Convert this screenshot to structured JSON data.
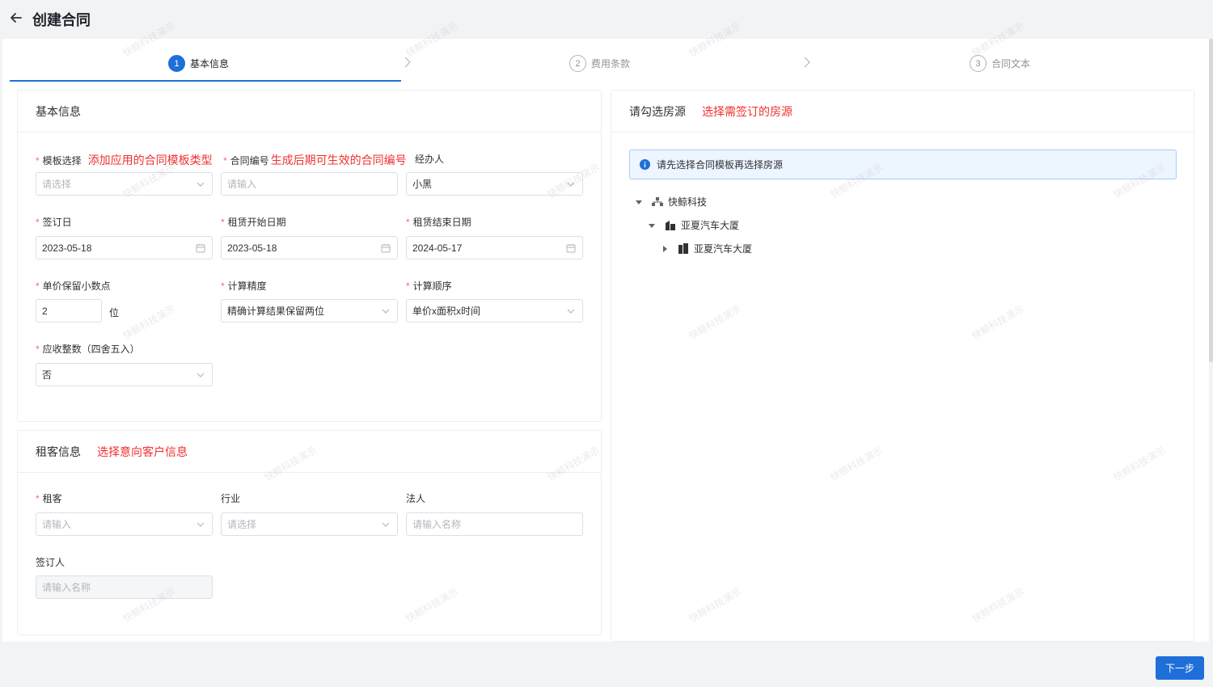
{
  "header": {
    "title": "创建合同"
  },
  "steps": [
    {
      "num": "1",
      "label": "基本信息"
    },
    {
      "num": "2",
      "label": "费用条款"
    },
    {
      "num": "3",
      "label": "合同文本"
    }
  ],
  "basic": {
    "title": "基本信息",
    "template": {
      "label": "模板选择",
      "annotation": "添加应用的合同模板类型",
      "placeholder": "请选择"
    },
    "contract_no": {
      "label": "合同编号",
      "annotation": "生成后期可生效的合同编号",
      "placeholder": "请输入"
    },
    "handler": {
      "label": "经办人",
      "value": "小黑"
    },
    "sign_date": {
      "label": "签订日",
      "value": "2023-05-18"
    },
    "lease_start": {
      "label": "租赁开始日期",
      "value": "2023-05-18"
    },
    "lease_end": {
      "label": "租赁结束日期",
      "value": "2024-05-17"
    },
    "decimals": {
      "label": "单价保留小数点",
      "value": "2",
      "unit": "位"
    },
    "precision": {
      "label": "计算精度",
      "value": "精确计算结果保留两位"
    },
    "order": {
      "label": "计算顺序",
      "value": "单价x面积x时间"
    },
    "rounding": {
      "label": "应收整数（四舍五入）",
      "value": "否"
    }
  },
  "tenant": {
    "title": "租客信息",
    "annotation": "选择意向客户信息",
    "tenant": {
      "label": "租客",
      "placeholder": "请输入"
    },
    "industry": {
      "label": "行业",
      "placeholder": "请选择"
    },
    "legal": {
      "label": "法人",
      "placeholder": "请输入名称"
    },
    "signer": {
      "label": "签订人",
      "placeholder": "请输入名称"
    }
  },
  "room": {
    "title": "请勾选房源",
    "annotation": "选择需签订的房源",
    "alert": "请先选择合同模板再选择房源",
    "tree": [
      {
        "label": "快鲸科技"
      },
      {
        "label": "亚夏汽车大厦"
      },
      {
        "label": "亚夏汽车大厦"
      }
    ]
  },
  "footer": {
    "next": "下一步"
  },
  "watermark": "快鲸科技演示",
  "colors": {
    "primary": "#1e6fd9",
    "annotation": "#f03030",
    "required": "#f56c6c"
  }
}
